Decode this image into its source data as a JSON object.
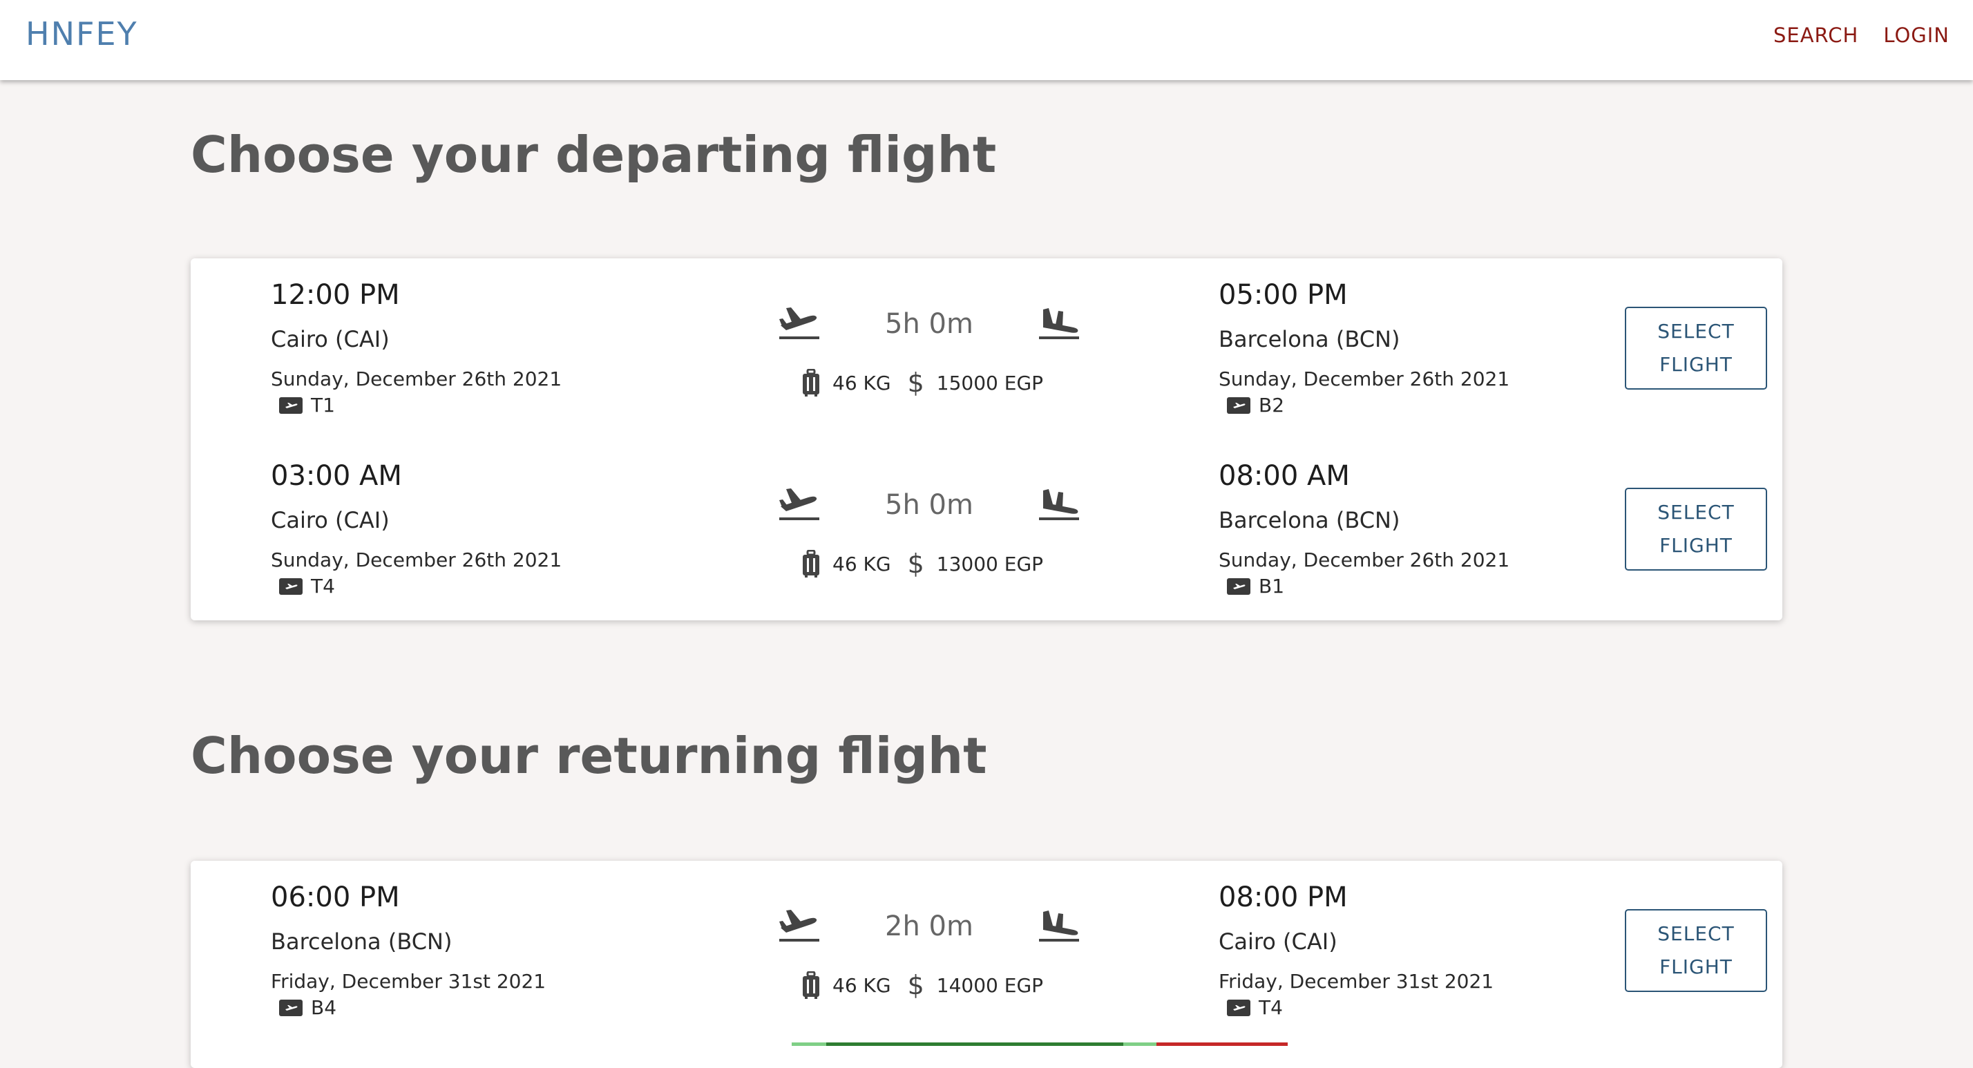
{
  "nav": {
    "brand": "HNFEY",
    "links": [
      {
        "label": "SEARCH"
      },
      {
        "label": "LOGIN"
      }
    ]
  },
  "departing": {
    "title": "Choose your departing flight",
    "flights": [
      {
        "dep_time": "12:00 PM",
        "dep_city": "Cairo (CAI)",
        "dep_date": "Sunday, December 26th 2021",
        "dep_terminal": "T1",
        "duration": "5h 0m",
        "baggage": "46 KG",
        "price": "15000 EGP",
        "arr_time": "05:00 PM",
        "arr_city": "Barcelona (BCN)",
        "arr_date": "Sunday, December 26th 2021",
        "arr_terminal": "B2",
        "button": "SELECT FLIGHT"
      },
      {
        "dep_time": "03:00 AM",
        "dep_city": "Cairo (CAI)",
        "dep_date": "Sunday, December 26th 2021",
        "dep_terminal": "T4",
        "duration": "5h 0m",
        "baggage": "46 KG",
        "price": "13000 EGP",
        "arr_time": "08:00 AM",
        "arr_city": "Barcelona (BCN)",
        "arr_date": "Sunday, December 26th 2021",
        "arr_terminal": "B1",
        "button": "SELECT FLIGHT"
      }
    ]
  },
  "returning": {
    "title": "Choose your returning flight",
    "flights": [
      {
        "dep_time": "06:00 PM",
        "dep_city": "Barcelona (BCN)",
        "dep_date": "Friday, December 31st 2021",
        "dep_terminal": "B4",
        "duration": "2h 0m",
        "baggage": "46 KG",
        "price": "14000 EGP",
        "arr_time": "08:00 PM",
        "arr_city": "Cairo (CAI)",
        "arr_date": "Friday, December 31st 2021",
        "arr_terminal": "T4",
        "button": "SELECT FLIGHT"
      }
    ]
  },
  "icons": {
    "takeoff": "airplane-takeoff-icon",
    "landing": "airplane-landing-icon",
    "luggage": "luggage-icon",
    "price": "dollar-icon",
    "terminal": "boarding-pass-icon"
  },
  "colors": {
    "brand": "#4f7fae",
    "nav_link": "#8b1a13",
    "button": "#2b5576",
    "background": "#f7f4f3"
  }
}
